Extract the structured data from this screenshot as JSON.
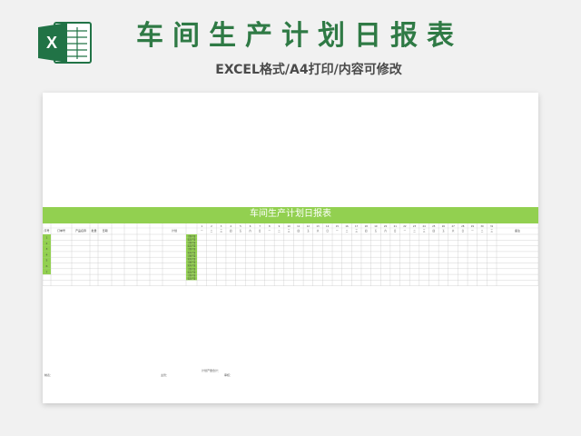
{
  "header": {
    "title": "车间生产计划日报表",
    "subtitle": "EXCEL格式/A4打印/内容可修改",
    "logo_letter": "X",
    "brand_color": "#217346"
  },
  "sheet": {
    "table_title": "车间生产计划日报表",
    "accent_color": "#92d050",
    "columns": [
      "序号",
      "订单号",
      "产品名称",
      "批量",
      "日期",
      "计划",
      "备注"
    ],
    "row_numbers": [
      "1",
      "2",
      "3",
      "4",
      "5",
      "6",
      "7"
    ],
    "plan_labels": [
      "计划产量",
      "实际产量"
    ],
    "day_numbers": [
      "1",
      "2",
      "3",
      "4",
      "5",
      "6",
      "7",
      "8",
      "9",
      "10",
      "11",
      "12",
      "13",
      "14",
      "15",
      "16",
      "17",
      "18",
      "19",
      "20",
      "21",
      "22",
      "23",
      "24",
      "25",
      "26",
      "27",
      "28",
      "29",
      "30",
      "31"
    ],
    "weekdays": [
      "一",
      "二",
      "三",
      "四",
      "五",
      "六",
      "日"
    ],
    "footer": {
      "plan_total": "计划产量合计：",
      "maker": "制表：",
      "manager": "主管：",
      "reviewer": "审核："
    }
  }
}
